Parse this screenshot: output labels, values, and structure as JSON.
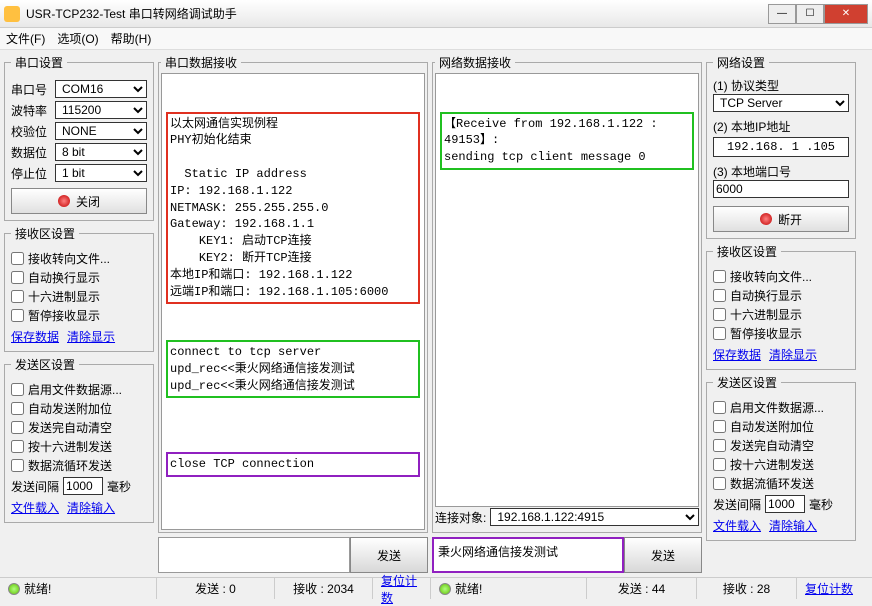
{
  "window": {
    "title": "USR-TCP232-Test 串口转网络调试助手"
  },
  "menu": {
    "file": "文件(F)",
    "options": "选项(O)",
    "help": "帮助(H)"
  },
  "serial_settings": {
    "legend": "串口设置",
    "port_label": "串口号",
    "port": "COM16",
    "baud_label": "波特率",
    "baud": "115200",
    "parity_label": "校验位",
    "parity": "NONE",
    "data_label": "数据位",
    "data": "8 bit",
    "stop_label": "停止位",
    "stop": "1 bit",
    "close_btn": "关闭"
  },
  "recv_settings": {
    "legend": "接收区设置",
    "c1": "接收转向文件...",
    "c2": "自动换行显示",
    "c3": "十六进制显示",
    "c4": "暂停接收显示",
    "save": "保存数据",
    "clear": "清除显示"
  },
  "send_settings": {
    "legend": "发送区设置",
    "c1": "启用文件数据源...",
    "c2": "自动发送附加位",
    "c3": "发送完自动清空",
    "c4": "按十六进制发送",
    "c5": "数据流循环发送",
    "interval_label": "发送间隔",
    "interval": "1000",
    "interval_unit": "毫秒",
    "load": "文件载入",
    "clear": "清除输入"
  },
  "serial_recv": {
    "legend": "串口数据接收",
    "block1": "以太网通信实现例程\nPHY初始化结束\n\n  Static IP address\nIP: 192.168.1.122\nNETMASK: 255.255.255.0\nGateway: 192.168.1.1\n    KEY1: 启动TCP连接\n    KEY2: 断开TCP连接\n本地IP和端口: 192.168.1.122\n远端IP和端口: 192.168.1.105:6000",
    "block2": "connect to tcp server\nupd_rec<<秉火网络通信接发测试\nupd_rec<<秉火网络通信接发测试",
    "block3": "close TCP connection"
  },
  "serial_send": {
    "button": "发送"
  },
  "net_recv": {
    "legend": "网络数据接收",
    "block1": "【Receive from 192.168.1.122 : 49153】:\nsending tcp client message 0"
  },
  "net_connect": {
    "label": "连接对象:",
    "value": "192.168.1.122:4915"
  },
  "net_send": {
    "input": "秉火网络通信接发测试",
    "button": "发送"
  },
  "net_settings": {
    "legend": "网络设置",
    "proto_label": "(1) 协议类型",
    "proto": "TCP Server",
    "ip_label": "(2) 本地IP地址",
    "ip": "192.168. 1 .105",
    "port_label": "(3) 本地端口号",
    "port": "6000",
    "disconnect_btn": "断开"
  },
  "status": {
    "ready": "就绪!",
    "s_send": "发送 : 0",
    "s_recv": "接收 : 2034",
    "s_reset": "复位计数",
    "n_send": "发送 : 44",
    "n_recv": "接收 : 28",
    "n_reset": "复位计数"
  }
}
